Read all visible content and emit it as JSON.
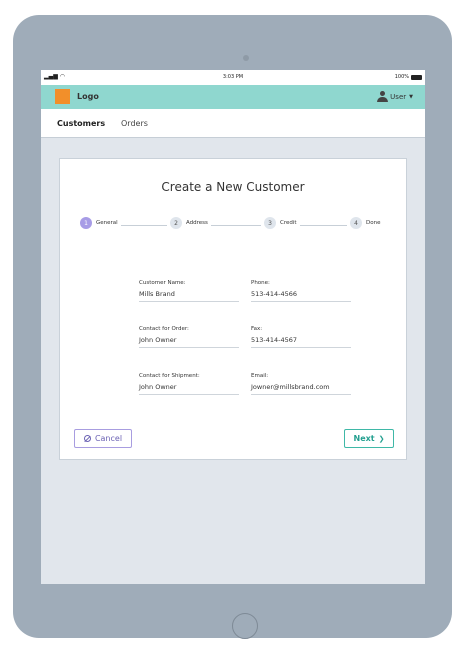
{
  "statusbar": {
    "signal": "▂▄▆ ◠",
    "time": "3:03 PM",
    "battery": "100%"
  },
  "appbar": {
    "logo_text": "Logo",
    "user_label": "User",
    "user_menu_caret": "▼",
    "logo_color": "#f28f2a",
    "bar_color": "#8fd7cf"
  },
  "nav": {
    "tabs": [
      {
        "label": "Customers",
        "active": true
      },
      {
        "label": "Orders",
        "active": false
      }
    ]
  },
  "form": {
    "title": "Create a New Customer",
    "steps": [
      {
        "num": "1",
        "label": "General",
        "active": true
      },
      {
        "num": "2",
        "label": "Address",
        "active": false
      },
      {
        "num": "3",
        "label": "Credit",
        "active": false
      },
      {
        "num": "4",
        "label": "Done",
        "active": false
      }
    ],
    "fields": [
      {
        "label": "Customer Name:",
        "value": "Mills Brand"
      },
      {
        "label": "Phone:",
        "value": "513-414-4566"
      },
      {
        "label": "Contact for Order:",
        "value": "John Owner"
      },
      {
        "label": "Fax:",
        "value": "513-414-4567"
      },
      {
        "label": "Contact for Shipment:",
        "value": "John Owner"
      },
      {
        "label": "Email:",
        "value": "Jowner@millsbrand.com"
      }
    ],
    "cancel_label": "Cancel",
    "next_label": "Next",
    "next_chevron": "❯"
  }
}
